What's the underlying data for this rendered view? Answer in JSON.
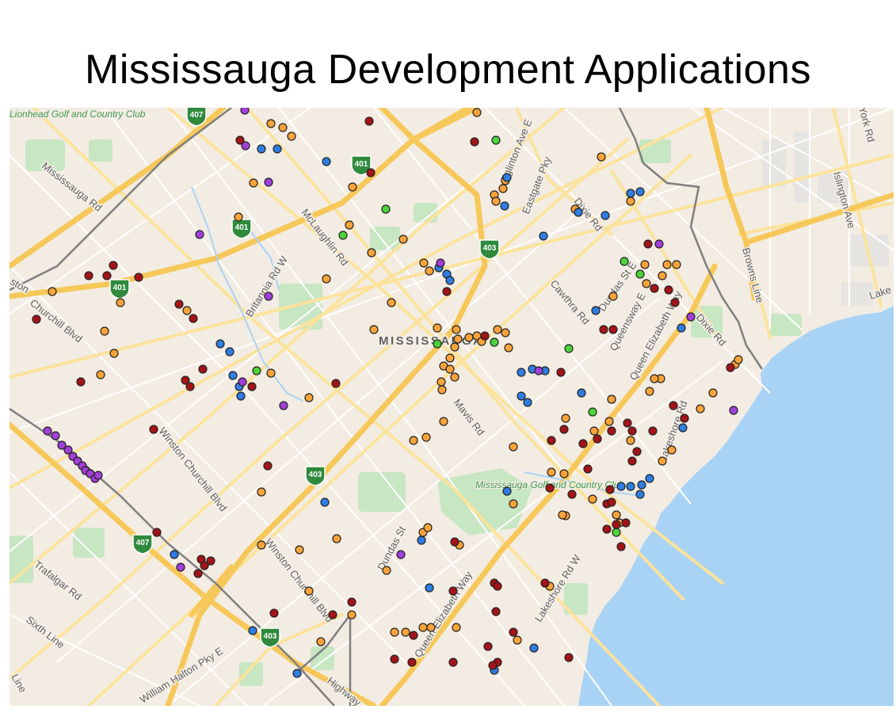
{
  "title": "Mississauga Development Applications",
  "colors": {
    "land": "#f3ece3",
    "water": "#a9d3f5",
    "park": "#c7e6c2",
    "highway": "#f6c85a",
    "arterial": "#fbe39c",
    "local_road": "#ffffff",
    "boundary": "#808080",
    "marker_orange": "#f9a33a",
    "marker_blue": "#2f7de1",
    "marker_darkred": "#a31419",
    "marker_purple": "#a23ed9",
    "marker_green": "#4cd43a"
  },
  "map": {
    "city_label": "MISSISSAUGA",
    "road_labels": [
      "Eglinton Ave E",
      "Eastgate Pky",
      "Dixie Rd",
      "McLaughlin Rd",
      "Britannia Rd W",
      "Mississauga Rd",
      "Churchill Blvd",
      "Cawthra Rd",
      "Dundas St E",
      "Queensway E",
      "Queen Elizabeth Way",
      "Dixie Rd",
      "Browns Line",
      "Islington Ave",
      "York Rd",
      "Lake",
      "Mavis Rd",
      "Winston Churchill Blvd",
      "Winston Churchill Blvd",
      "Trafalgar Rd",
      "Sixth Line",
      "William Halton Pky E",
      "Highway",
      "Dundas St",
      "Queen Elizabeth Way",
      "Lakeshore Rd W",
      "Lakeshore Rd",
      "Line",
      "ston"
    ],
    "park_labels": [
      "Lionhead Golf and Country Club",
      "Mississauga Golf and Country Club"
    ],
    "highway_shields": [
      "407",
      "401",
      "401",
      "401",
      "403",
      "403",
      "407",
      "403"
    ]
  }
}
